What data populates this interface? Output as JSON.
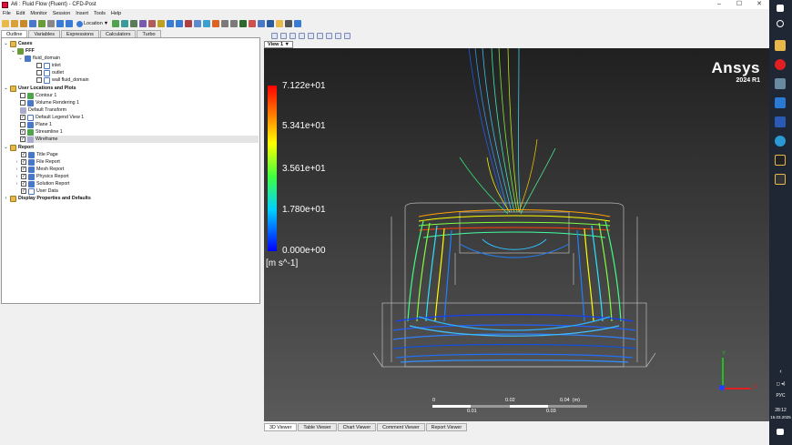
{
  "window": {
    "title": "A6 : Fluid Flow (Fluent) - CFD-Post",
    "controls": [
      "–",
      "☐",
      "✕"
    ]
  },
  "menu": [
    "File",
    "Edit",
    "Monitor",
    "Session",
    "Insert",
    "Tools",
    "Help"
  ],
  "toolbar": {
    "location_label": "Location"
  },
  "left_tabs": [
    "Outline",
    "Variables",
    "Expressions",
    "Calculators",
    "Turbo"
  ],
  "tree": {
    "cases": "Cases",
    "fff": "FFF",
    "fluid_domain": "fluid_domain",
    "inlet": "inlet",
    "outlet": "outlet",
    "wall": "wall fluid_domain",
    "user_locations": "User Locations and Plots",
    "contour": "Contour 1",
    "volume_rendering": "Volume Rendering 1",
    "default_transform": "Default Transform",
    "default_legend": "Default Legend View 1",
    "plane": "Plane 1",
    "streamline": "Streamline 1",
    "wireframe": "Wireframe",
    "report": "Report",
    "title_page": "Title Page",
    "file_report": "File Report",
    "mesh_report": "Mesh Report",
    "physics_report": "Physics Report",
    "solution_report": "Solution Report",
    "user_data": "User Data",
    "display_props": "Display Properties and Defaults"
  },
  "viewer": {
    "view_label": "View 1 ▼",
    "legend_labels": [
      "7.122e+01",
      "5.341e+01",
      "3.561e+01",
      "1.780e+01",
      "0.000e+00"
    ],
    "legend_unit": "[m s^-1]",
    "brand": "Ansys",
    "version": "2024 R1",
    "scale_top": [
      "0",
      "0.02",
      "0.04  (m)"
    ],
    "scale_bottom": [
      "0.01",
      "0.03"
    ],
    "axis_x": "X",
    "axis_y": "Y"
  },
  "bottom_tabs": [
    "3D Viewer",
    "Table Viewer",
    "Chart Viewer",
    "Comment Viewer",
    "Report Viewer"
  ],
  "taskbar": {
    "lang": "РУС",
    "time": "28:12",
    "date": "15.03.2025"
  }
}
